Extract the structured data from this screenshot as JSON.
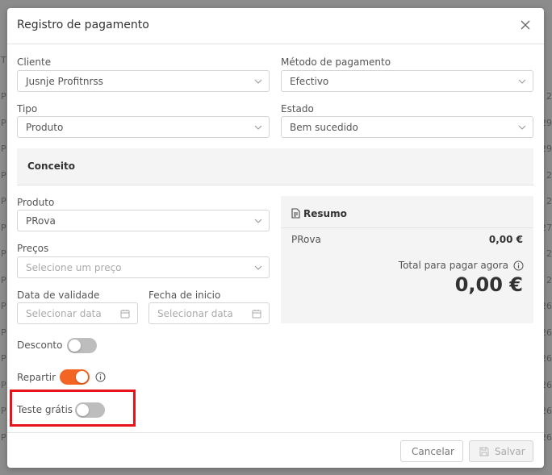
{
  "background": {
    "col_header": "T",
    "row_letter": "P",
    "row_digits": [
      "2",
      "29",
      "29",
      "2",
      "2",
      "27",
      "2",
      "2",
      "26",
      "26",
      "26",
      "26",
      "26",
      "26"
    ]
  },
  "modal": {
    "title": "Registro de pagamento"
  },
  "form": {
    "cliente": {
      "label": "Cliente",
      "value": "Jusnje Profitnrss"
    },
    "metodo": {
      "label": "Método de pagamento",
      "value": "Efectivo"
    },
    "tipo": {
      "label": "Tipo",
      "value": "Produto"
    },
    "estado": {
      "label": "Estado",
      "value": "Bem sucedido"
    }
  },
  "concept": {
    "title": "Conceito",
    "produto": {
      "label": "Produto",
      "value": "PRova"
    },
    "precos": {
      "label": "Preços",
      "placeholder": "Selecione um preço"
    },
    "validade": {
      "label": "Data de validade",
      "placeholder": "Selecionar data"
    },
    "inicio": {
      "label": "Fecha de inicio",
      "placeholder": "Selecionar data"
    }
  },
  "summary": {
    "title": "Resumo",
    "item_name": "PRova",
    "item_price": "0,00 €",
    "total_label": "Total para pagar agora",
    "total_value": "0,00 €"
  },
  "toggles": {
    "desconto": {
      "label": "Desconto",
      "on": false
    },
    "repartir": {
      "label": "Repartir",
      "on": true
    },
    "teste": {
      "label": "Teste grátis",
      "on": false
    }
  },
  "footer": {
    "cancel_label": "Cancelar",
    "save_label": "Salvar"
  },
  "colors": {
    "accent": "#f26522",
    "highlight": "#e8141b"
  }
}
